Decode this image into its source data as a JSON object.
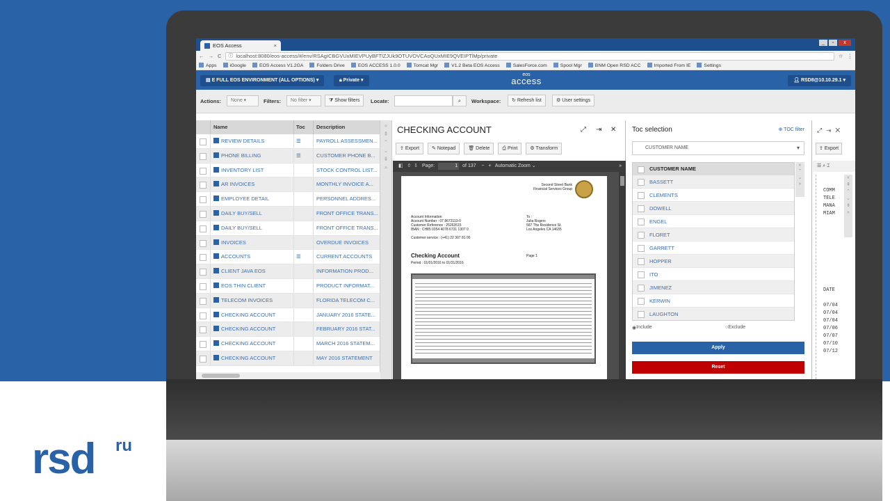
{
  "browser": {
    "tab_title": "EOS Access",
    "tab_close": "×",
    "url": "localhost:8080/eos-access/#/env/RSAgICBGVUxMIEVPUyBFTlZJUk9OTUVOVCAoQUxMIE9QVEIPTlMp/private",
    "nav_icons": [
      "←",
      "→",
      "C"
    ],
    "win_buttons": [
      "_",
      "▫",
      "x"
    ],
    "bookmarks": [
      "Apps",
      "iGoogle",
      "EOS Access V1.2GA",
      "Folders Drive",
      "EOS ACCESS 1.0.0",
      "Tomcat Mgr",
      "V1.2 Beta EOS Access",
      "SalesForce.com",
      "Spool Mgr",
      "BNM Open RSD ACC",
      "Imported From IE",
      "Settings"
    ]
  },
  "header": {
    "environment": "E FULL EOS ENVIRONMENT (ALL OPTIONS)",
    "privacy": "Private",
    "brand_small": "eos",
    "brand": "access",
    "user": "RSD8@10.10.29.1"
  },
  "toolbar": {
    "actions_label": "Actions:",
    "actions_value": "None",
    "filters_label": "Filters:",
    "filters_value": "No filter",
    "show_filters": "Show filters",
    "locate_label": "Locate:",
    "workspace_label": "Workspace:",
    "refresh": "Refresh list",
    "user_settings": "User settings"
  },
  "list": {
    "columns": {
      "name": "Name",
      "toc": "Toc",
      "description": "Description"
    },
    "rows": [
      {
        "name": "REVIEW DETAILS",
        "toc": "☰",
        "desc": "PAYROLL ASSESSMEN..."
      },
      {
        "name": "PHONE BILLING",
        "toc": "☰",
        "desc": "CUSTOMER PHONE B..."
      },
      {
        "name": "INVENTORY LIST",
        "toc": "",
        "desc": "STOCK CONTROL LIST..."
      },
      {
        "name": "AR INVOICES",
        "toc": "",
        "desc": "MONTHLY INVOICE A..."
      },
      {
        "name": "EMPLOYEE DETAIL",
        "toc": "",
        "desc": "PERSONNEL ADDRES..."
      },
      {
        "name": "DAILY BUY/SELL",
        "toc": "",
        "desc": "FRONT OFFICE TRANS..."
      },
      {
        "name": "DAILY BUY/SELL",
        "toc": "",
        "desc": "FRONT OFFICE TRANS..."
      },
      {
        "name": "INVOICES",
        "toc": "",
        "desc": "OVERDUE INVOICES"
      },
      {
        "name": "ACCOUNTS",
        "toc": "☰",
        "desc": "CURRENT ACCOUNTS"
      },
      {
        "name": "CLIENT JAVA EOS",
        "toc": "",
        "desc": "INFORMATION PROD..."
      },
      {
        "name": "EOS THIN CLIENT",
        "toc": "",
        "desc": "PRODUCT INFORMAT..."
      },
      {
        "name": "TELECOM INVOICES",
        "toc": "",
        "desc": "FLORIDA TELECOM C..."
      },
      {
        "name": "CHECKING ACCOUNT",
        "toc": "",
        "desc": "JANUARY 2016 STATE..."
      },
      {
        "name": "CHECKING ACCOUNT",
        "toc": "",
        "desc": "FEBRUARY 2016 STAT..."
      },
      {
        "name": "CHECKING ACCOUNT",
        "toc": "",
        "desc": "MARCH 2016 STATEM..."
      },
      {
        "name": "CHECKING ACCOUNT",
        "toc": "",
        "desc": "MAY 2016 STATEMENT"
      }
    ]
  },
  "document": {
    "title": "CHECKING ACCOUNT",
    "buttons": [
      "Export",
      "Notepad",
      "Delete",
      "Print",
      "Transform"
    ],
    "pdf": {
      "page_label": "Page:",
      "page": "1",
      "of": "of 137",
      "zoom": "Automatic Zoom"
    },
    "page": {
      "bank_line1": "Second Street Bank",
      "bank_line2": "Financial Services Group",
      "acct_info": "Account Information",
      "acct_number": "Account Number : 07 8673113-0",
      "cust_ref": "Customer Reference : 25263515",
      "iban": "IBAN : CH85 0354 4078 6731 1307 0",
      "to_label": "To :",
      "to_name": "Julia Rogers",
      "to_addr1": "567 The Residence St.",
      "to_addr2": "Los Angeles CA 14635",
      "service": "Customer service : (+41) 22 307 81 00",
      "title": "Checking Account",
      "period": "Period : 01/01/2016 to 01/31/2016",
      "page_no": "Page 1"
    }
  },
  "toc": {
    "title": "Toc selection",
    "filter": "TOC filter",
    "selector": "CUSTOMER NAME",
    "header": "CUSTOMER NAME",
    "items": [
      "BASSETT",
      "CLEMENTS",
      "DOWELL",
      "ENGEL",
      "FLORET",
      "GARRETT",
      "HOPPER",
      "ITO",
      "JIMENEZ",
      "KERWIN",
      "LAUGHTON"
    ],
    "include": "Include",
    "exclude": "Exclude",
    "apply": "Apply",
    "reset": "Reset"
  },
  "right_panel": {
    "export": "Export",
    "text": "COMM\nTELE\nMANA\nMIAM\n\n\n\n\n\n\n\n\n\nDATE\n\n07/04\n07/04\n07/04\n07/06\n07/07\n07/10\n07/12"
  },
  "colors": {
    "brand_blue": "#2a62a7",
    "reset_red": "#c00000"
  }
}
